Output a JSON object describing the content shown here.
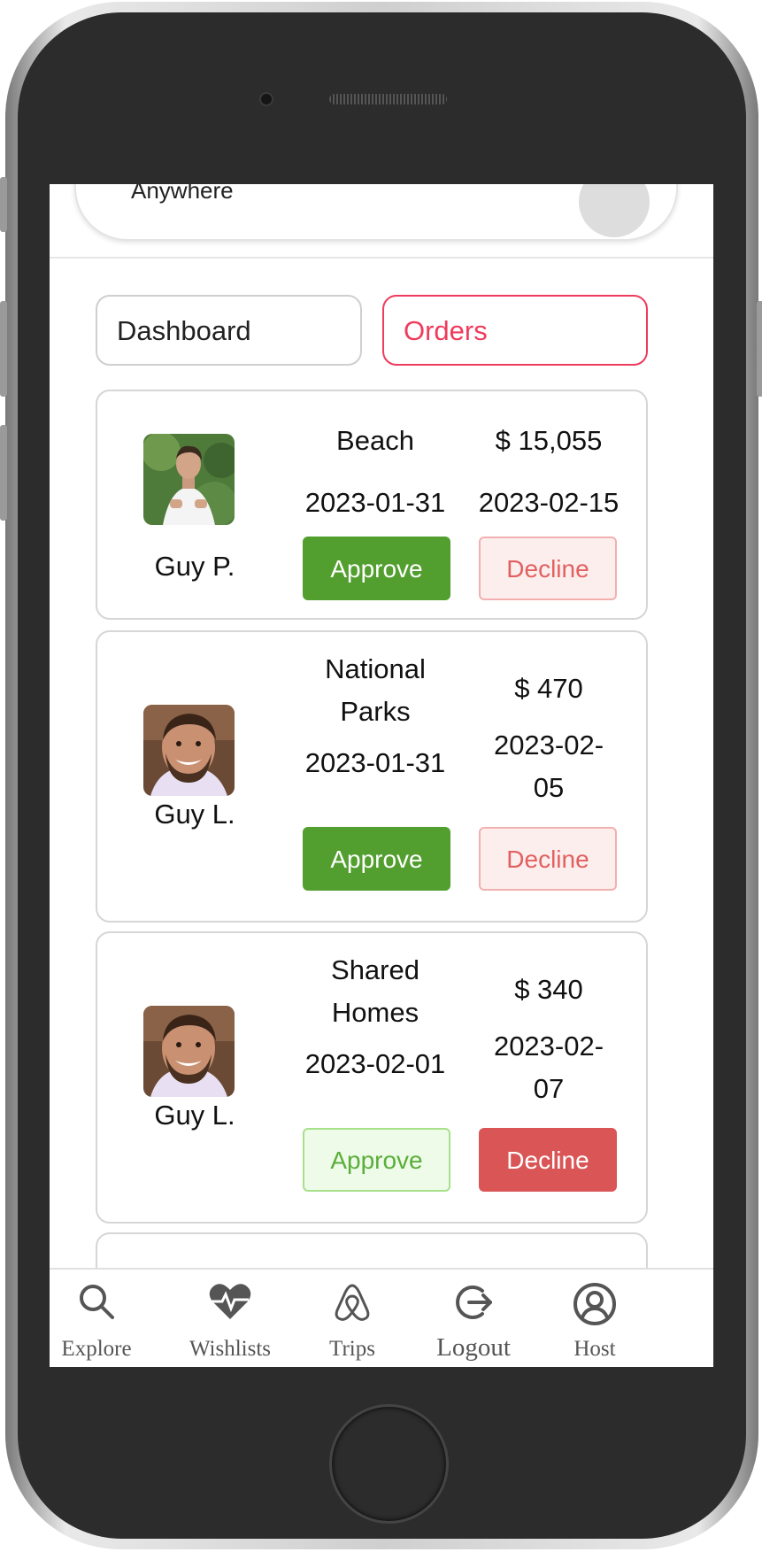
{
  "search": {
    "text": "Anywhere"
  },
  "tabs": [
    {
      "label": "Dashboard",
      "active": false
    },
    {
      "label": "Orders",
      "active": true
    }
  ],
  "orders": [
    {
      "guest": "Guy P.",
      "category": "Beach",
      "price": "$ 15,055",
      "check_in": "2023-01-31",
      "check_out": "2023-02-15",
      "approve_label": "Approve",
      "decline_label": "Decline",
      "status": "pending"
    },
    {
      "guest": "Guy L.",
      "category": "National Parks",
      "price": "$ 470",
      "check_in": "2023-01-31",
      "check_out": "2023-02-05",
      "approve_label": "Approve",
      "decline_label": "Decline",
      "status": "pending"
    },
    {
      "guest": "Guy L.",
      "category": "Shared Homes",
      "price": "$ 340",
      "check_in": "2023-02-01",
      "check_out": "2023-02-07",
      "approve_label": "Approve",
      "decline_label": "Decline",
      "status": "declined"
    }
  ],
  "nav": [
    {
      "label": "Explore",
      "icon": "search-icon"
    },
    {
      "label": "Wishlists",
      "icon": "heartbeat-icon"
    },
    {
      "label": "Trips",
      "icon": "airbnb-logo-icon"
    },
    {
      "label": "Logout",
      "icon": "logout-icon"
    },
    {
      "label": "Host",
      "icon": "user-circle-icon"
    }
  ],
  "colors": {
    "brand": "#ef3b5c",
    "approve": "#529f2f",
    "decline": "#da5656"
  }
}
